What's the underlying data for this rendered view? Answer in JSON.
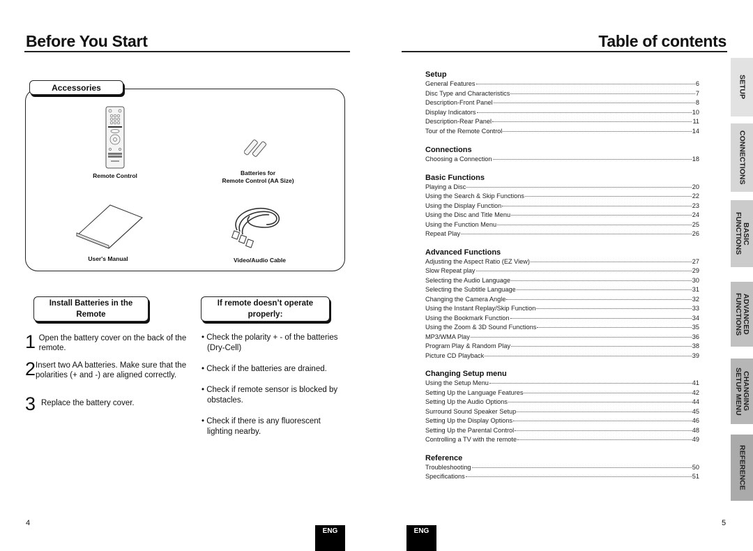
{
  "left_page": {
    "title": "Before You Start",
    "accessories": {
      "heading": "Accessories",
      "items": [
        {
          "label": "Remote Control",
          "icon": "remote-control-icon"
        },
        {
          "label_line1": "Batteries for",
          "label_line2": "Remote Control (AA Size)",
          "icon": "batteries-icon"
        },
        {
          "label": "User's Manual",
          "icon": "manual-icon"
        },
        {
          "label": "Video/Audio Cable",
          "icon": "av-cable-icon"
        }
      ]
    },
    "install": {
      "heading_line1": "Install Batteries in the",
      "heading_line2": "Remote",
      "steps": [
        {
          "num": "1",
          "text": "Open the battery cover on the back of the remote."
        },
        {
          "num": "2",
          "text": "Insert two AA batteries. Make sure that the polarities (+ and -) are aligned correctly."
        },
        {
          "num": "3",
          "text": "Replace the battery cover."
        }
      ]
    },
    "troubleshoot": {
      "heading_line1": "If remote doesn’t operate",
      "heading_line2": "properly:",
      "bullets": [
        "• Check the polarity + - of the batteries (Dry-Cell)",
        "• Check if the batteries are drained.",
        "• Check if remote sensor is blocked by obstacles.",
        "• Check if there is any fluorescent lighting nearby."
      ]
    },
    "page_number": "4",
    "lang_badge": "ENG"
  },
  "right_page": {
    "title": "Table of contents",
    "sections": [
      {
        "heading": "Setup",
        "entries": [
          {
            "title": "General Features",
            "page": "6"
          },
          {
            "title": "Disc Type and Characteristics",
            "page": "7"
          },
          {
            "title": "Description-Front Panel",
            "page": "8"
          },
          {
            "title": "Display Indicators",
            "page": "10"
          },
          {
            "title": "Description-Rear Panel",
            "page": "11"
          },
          {
            "title": "Tour of the Remote Control",
            "page": "14"
          }
        ]
      },
      {
        "heading": "Connections",
        "entries": [
          {
            "title": "Choosing a Connection",
            "page": "18"
          }
        ]
      },
      {
        "heading": "Basic Functions",
        "entries": [
          {
            "title": "Playing a Disc",
            "page": "20"
          },
          {
            "title": "Using the Search & Skip Functions",
            "page": "22"
          },
          {
            "title": "Using the Display Function",
            "page": "23"
          },
          {
            "title": "Using the Disc and Title Menu",
            "page": "24"
          },
          {
            "title": "Using the Function Menu",
            "page": "25"
          },
          {
            "title": "Repeat Play",
            "page": "26"
          }
        ]
      },
      {
        "heading": "Advanced Functions",
        "entries": [
          {
            "title": "Adjusting the Aspect Ratio (EZ View)",
            "page": "27"
          },
          {
            "title": "Slow Repeat play",
            "page": "29"
          },
          {
            "title": "Selecting the Audio Language",
            "page": "30"
          },
          {
            "title": "Selecting the Subtitle Language",
            "page": "31"
          },
          {
            "title": "Changing the Camera Angle",
            "page": "32"
          },
          {
            "title": "Using the Instant Replay/Skip Function",
            "page": "33"
          },
          {
            "title": "Using the Bookmark Function",
            "page": "34"
          },
          {
            "title": "Using the Zoom & 3D Sound Functions",
            "page": "35"
          },
          {
            "title": "MP3/WMA Play",
            "page": "36"
          },
          {
            "title": "Program Play & Random Play",
            "page": "38"
          },
          {
            "title": "Picture CD Playback",
            "page": "39"
          }
        ]
      },
      {
        "heading": "Changing Setup menu",
        "entries": [
          {
            "title": "Using the Setup Menu",
            "page": "41"
          },
          {
            "title": "Setting Up the Language Features",
            "page": "42"
          },
          {
            "title": "Setting Up the Audio Options",
            "page": "44"
          },
          {
            "title": "Surround Sound Speaker Setup",
            "page": "45"
          },
          {
            "title": "Setting Up the Display Options",
            "page": "46"
          },
          {
            "title": "Setting Up the Parental Control",
            "page": "48"
          },
          {
            "title": "Controlling a TV with the remote",
            "page": "49"
          }
        ]
      },
      {
        "heading": "Reference",
        "entries": [
          {
            "title": "Troubleshooting",
            "page": "50"
          },
          {
            "title": "Specifications",
            "page": "51"
          }
        ]
      }
    ],
    "side_tabs": [
      {
        "label": "SETUP",
        "color": "#e2e2e2"
      },
      {
        "label": "CONNECTIONS",
        "color": "#d6d6d6"
      },
      {
        "label": "BASIC\nFUNCTIONS",
        "color": "#cbcbcb"
      },
      {
        "label": "ADVANCED\nFUNCTIONS",
        "color": "#c0c0c0"
      },
      {
        "label": "CHANGING\nSETUP MENU",
        "color": "#b6b6b6"
      },
      {
        "label": "REFERENCE",
        "color": "#aaaaaa"
      }
    ],
    "page_number": "5",
    "lang_badge": "ENG"
  }
}
